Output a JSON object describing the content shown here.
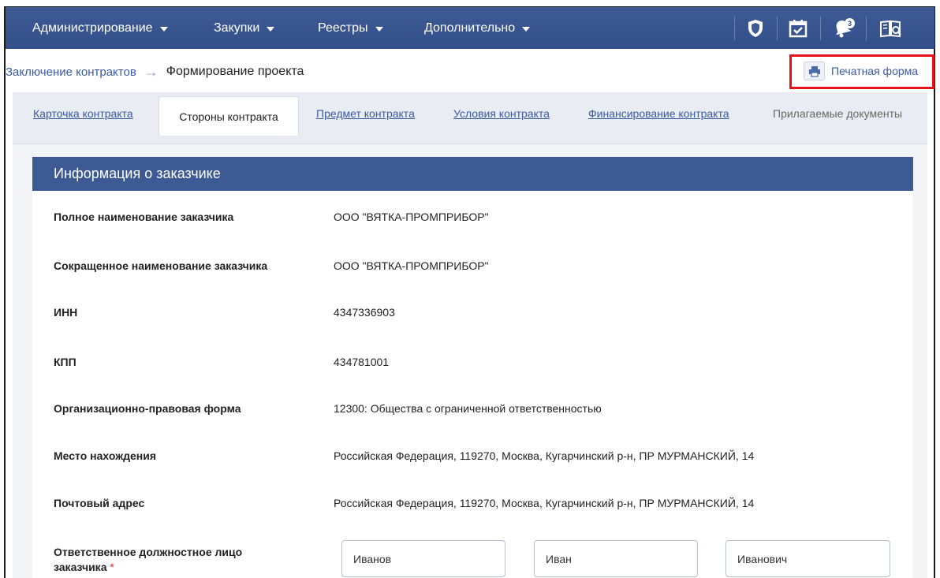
{
  "nav": {
    "items": [
      {
        "label": "Администрирование"
      },
      {
        "label": "Закупки"
      },
      {
        "label": "Реестры"
      },
      {
        "label": "Дополнительно"
      }
    ],
    "notification_count": "3"
  },
  "breadcrumb": {
    "parent": "Заключение контрактов",
    "current": "Формирование проекта"
  },
  "print_button": {
    "label": "Печатная форма"
  },
  "tabs": [
    {
      "label": "Карточка контракта"
    },
    {
      "label": "Стороны контракта"
    },
    {
      "label": "Предмет контракта"
    },
    {
      "label": "Условия контракта"
    },
    {
      "label": "Финансирование контракта"
    },
    {
      "label": "Прилагаемые документы"
    }
  ],
  "section": {
    "title": "Информация о заказчике",
    "rows": [
      {
        "label": "Полное наименование заказчика",
        "value": "ООО \"ВЯТКА-ПРОМПРИБОР\""
      },
      {
        "label": "Сокращенное наименование заказчика",
        "value": "ООО \"ВЯТКА-ПРОМПРИБОР\""
      },
      {
        "label": "ИНН",
        "value": "4347336903"
      },
      {
        "label": "КПП",
        "value": "434781001"
      },
      {
        "label": "Организационно-правовая форма",
        "value": "12300: Общества с ограниченной ответственностью"
      },
      {
        "label": "Место нахождения",
        "value": "Российская Федерация, 119270, Москва, Кугарчинский р-н, ПР МУРМАНСКИЙ, 14"
      },
      {
        "label": "Почтовый адрес",
        "value": "Российская Федерация, 119270, Москва, Кугарчинский р-н, ПР МУРМАНСКИЙ, 14"
      }
    ],
    "responsible": {
      "label_line1": "Ответственное должностное лицо",
      "label_line2": "заказчика",
      "required_mark": "*",
      "last_name": "Иванов",
      "first_name": "Иван",
      "middle_name": "Иванович"
    }
  }
}
